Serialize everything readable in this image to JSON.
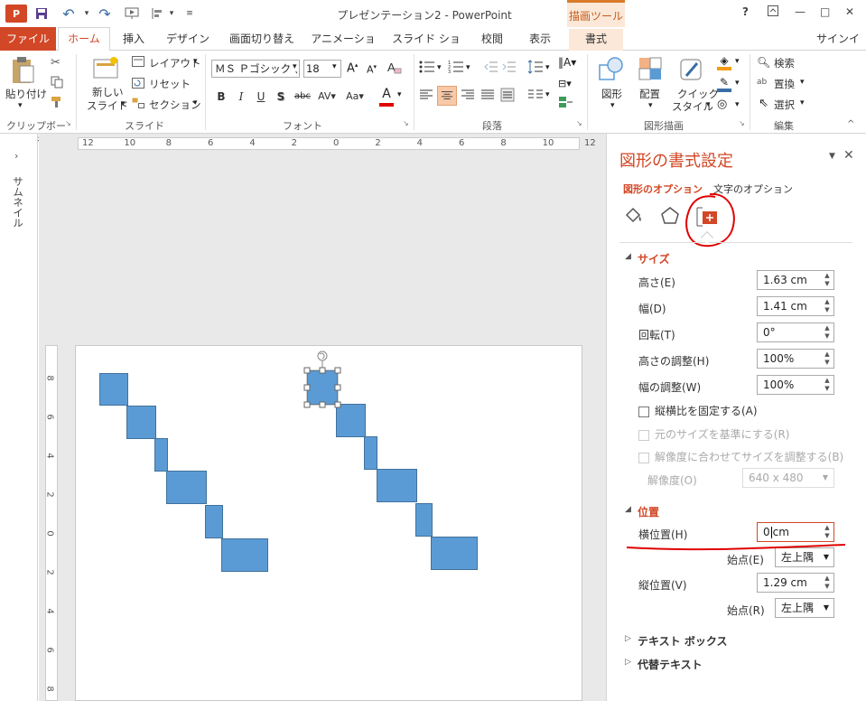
{
  "app": {
    "title": "プレゼンテーション2 - PowerPoint",
    "context_tab_group": "描画ツール"
  },
  "window": {
    "help": "?",
    "min": "—",
    "max": "□",
    "close": "✕"
  },
  "tabs": {
    "file": "ファイル",
    "home": "ホーム",
    "insert": "挿入",
    "design": "デザイン",
    "transitions": "画面切り替え",
    "animations": "アニメーション",
    "slideshow": "スライド ショー",
    "review": "校閲",
    "view": "表示",
    "format": "書式",
    "signin": "サインイン"
  },
  "ribbon": {
    "clipboard": {
      "paste": "貼り付け",
      "label": "クリップボード"
    },
    "slides": {
      "new_slide_1": "新しい",
      "new_slide_2": "スライド",
      "layout": "レイアウト",
      "reset": "リセット",
      "section": "セクション",
      "label": "スライド"
    },
    "font": {
      "name": "ＭＳ Ｐゴシック (本文)",
      "size": "18",
      "label": "フォント"
    },
    "paragraph": {
      "label": "段落"
    },
    "drawing": {
      "shapes": "図形",
      "arrange": "配置",
      "quick_style_1": "クイック",
      "quick_style_2": "スタイル",
      "label": "図形描画"
    },
    "editing": {
      "find": "検索",
      "replace": "置換",
      "select": "選択",
      "label": "編集"
    }
  },
  "thumbnail_pane": {
    "label": "サムネイル"
  },
  "rulers": {
    "h_ticks": [
      "12",
      "10",
      "8",
      "6",
      "4",
      "2",
      "0",
      "2",
      "4",
      "6",
      "8",
      "10",
      "12"
    ],
    "v_ticks": [
      "8",
      "6",
      "4",
      "2",
      "0",
      "2",
      "4",
      "6",
      "8"
    ]
  },
  "format_pane": {
    "title": "図形の書式設定",
    "tab_shape_options": "図形のオプション",
    "tab_text_options": "文字のオプション",
    "size_section": "サイズ",
    "height_label": "高さ(E)",
    "height_value": "1.63 cm",
    "width_label": "幅(D)",
    "width_value": "1.41 cm",
    "rotation_label": "回転(T)",
    "rotation_value": "0°",
    "scale_h_label": "高さの調整(H)",
    "scale_h_value": "100%",
    "scale_w_label": "幅の調整(W)",
    "scale_w_value": "100%",
    "lock_aspect": "縦横比を固定する(A)",
    "relative_original": "元のサイズを基準にする(R)",
    "best_scale": "解像度に合わせてサイズを調整する(B)",
    "resolution_label": "解像度(O)",
    "resolution_value": "640 x 480",
    "position_section": "位置",
    "hpos_label": "横位置(H)",
    "hpos_value": "0",
    "hpos_unit": "cm",
    "hfrom_label": "始点(E)",
    "hfrom_value": "左上隅",
    "vpos_label": "縦位置(V)",
    "vpos_value": "1.29 cm",
    "vfrom_label": "始点(R)",
    "vfrom_value": "左上隅",
    "textbox_section": "テキスト ボックス",
    "alttext_section": "代替テキスト"
  },
  "colors": {
    "accent": "#d24726",
    "shape_fill": "#5b9bd5",
    "annotation": "#e00000"
  }
}
